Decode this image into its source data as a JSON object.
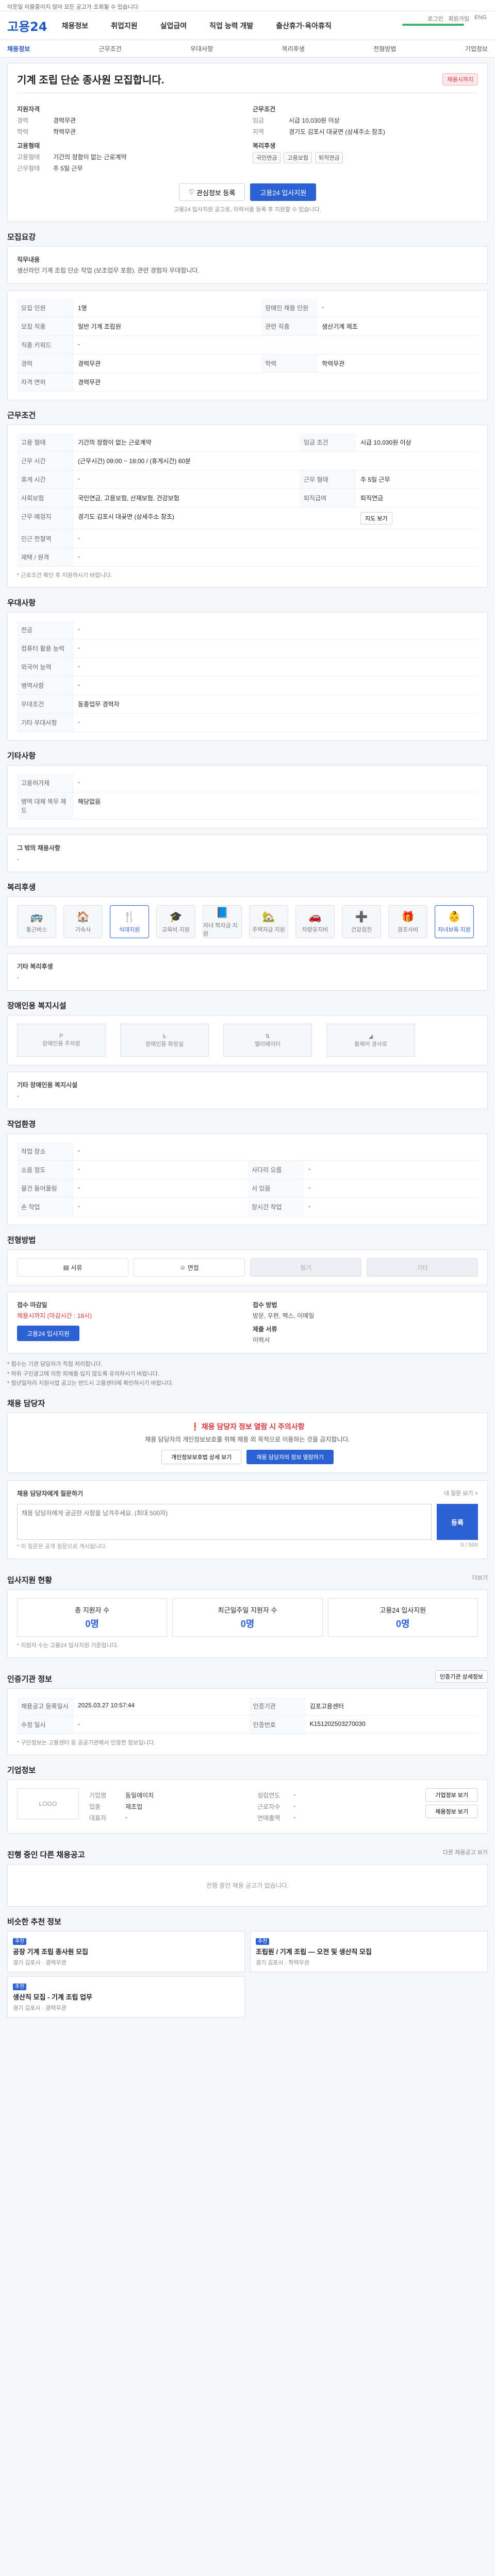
{
  "topbar": {
    "text": "이웃일 이용중이지 않아 모든 공고가 조회될 수 있습니다"
  },
  "header": {
    "logo": "고용24",
    "nav": [
      "채용정보",
      "취업지원",
      "실업급여",
      "직업 능력 개발",
      "출산휴가·육아휴직"
    ],
    "tools": [
      "로그인",
      "회원가입",
      "ENG"
    ]
  },
  "subnav": {
    "items": [
      "채용정보",
      "근무조건",
      "우대사항",
      "복리후생",
      "전형방법",
      "기업정보"
    ]
  },
  "job": {
    "title": "기계 조립 단순 종사원 모집합니다.",
    "badge": "채용시까지",
    "left_title": "지원자격",
    "left_rows": [
      {
        "k": "경력",
        "v": "경력무관"
      },
      {
        "k": "학력",
        "v": "학력무관"
      }
    ],
    "left_title2": "고용형태",
    "left_rows2": [
      {
        "k": "고용형태",
        "v": "기간의 정함이 없는 근로계약"
      },
      {
        "k": "근무형태",
        "v": "주 5일 근무"
      }
    ],
    "right_title": "근무조건",
    "right_rows": [
      {
        "k": "임금",
        "v": "시급 10,030원 이상"
      },
      {
        "k": "지역",
        "v": "경기도 김포시 대곶면 (상세주소 참조)"
      }
    ],
    "right_title2": "복리후생",
    "chips": [
      "국민연금",
      "고용보험",
      "퇴직연금"
    ],
    "btn_scrap": "관심정보 등록",
    "btn_apply": "고용24 입사지원",
    "note": "고용24 입사지원 공고로, 이력서를 등록 후 지원할 수 있습니다."
  },
  "duty": {
    "title": "모집요강",
    "box_title": "직무내용",
    "box_text": "생산라인 기계 조립 단순 작업 (보조업무 포함). 관련 경험자 우대합니다.",
    "rows": [
      [
        {
          "k": "모집 인원",
          "v": "1명"
        },
        {
          "k": "장애인 채용 인원",
          "v": "-"
        }
      ],
      [
        {
          "k": "모집 직종",
          "v": "일반 기계 조립원"
        },
        {
          "k": "관련 직종",
          "v": "생산기계 제조"
        }
      ],
      [
        {
          "k": "직종 키워드",
          "v": "-"
        },
        {
          "k": "",
          "v": ""
        }
      ],
      [
        {
          "k": "경력",
          "v": "경력무관"
        },
        {
          "k": "학력",
          "v": "학력무관"
        }
      ],
      [
        {
          "k": "자격 면허",
          "v": "경력무관"
        },
        {
          "k": "",
          "v": ""
        }
      ]
    ]
  },
  "cond": {
    "title": "근무조건",
    "rows": [
      [
        {
          "k": "고용 형태",
          "v": "기간의 정함이 없는 근로계약"
        },
        {
          "k": "임금 조건",
          "v": "시급 10,030원 이상"
        }
      ],
      [
        {
          "k": "근무 시간",
          "v": "(근무시간) 09:00 ~ 18:00 / (휴게시간) 60분"
        },
        {
          "k": "",
          "v": ""
        }
      ],
      [
        {
          "k": "휴게 시간",
          "v": "-"
        },
        {
          "k": "근무 형태",
          "v": "주 5일 근무"
        }
      ],
      [
        {
          "k": "사회보험",
          "v": "국민연금, 고용보험, 산재보험, 건강보험"
        },
        {
          "k": "퇴직급여",
          "v": "퇴직연금"
        }
      ],
      [
        {
          "k": "근무 예정지",
          "v": "경기도 김포시 대곶면 (상세주소 참조)"
        },
        {
          "k": "",
          "v": ""
        }
      ],
      [
        {
          "k": "인근 전철역",
          "v": "-"
        },
        {
          "k": "",
          "v": ""
        }
      ],
      [
        {
          "k": "재택 / 원격",
          "v": "-"
        },
        {
          "k": "",
          "v": ""
        }
      ]
    ],
    "map_btn": "지도 보기",
    "footnote": "* 근로조건 확인 후 지원하시기 바랍니다."
  },
  "prefer": {
    "title": "우대사항",
    "rows": [
      {
        "k": "전공",
        "v": "-"
      },
      {
        "k": "컴퓨터 활용 능력",
        "v": "-"
      },
      {
        "k": "외국어 능력",
        "v": "-"
      },
      {
        "k": "병역사항",
        "v": "-"
      },
      {
        "k": "우대조건",
        "v": "동종업무 경력자"
      },
      {
        "k": "기타 우대사항",
        "v": "-"
      }
    ]
  },
  "etc": {
    "title": "기타사항",
    "rows": [
      {
        "k": "고용허가제",
        "v": "-"
      },
      {
        "k": "병역 대체 복무 제도",
        "v": "해당없음"
      }
    ],
    "other_title": "그 밖의 채용사항",
    "other_text": "-"
  },
  "welfare": {
    "title": "복리후생",
    "items": [
      "통근버스",
      "기숙사",
      "식대지원",
      "교육비 지원",
      "자녀 학자금 지원",
      "주택자금 지원",
      "차량유지비",
      "건강검진",
      "경조사비",
      "자녀보육 지원"
    ],
    "extra_title": "기타 복리후생",
    "extra_text": "-"
  },
  "disabled": {
    "title": "장애인용 복지시설",
    "items": [
      "장애인용 주차장",
      "장애인용 화장실",
      "엘리베이터",
      "휠체어 경사로"
    ],
    "extra_title": "기타 장애인용 복지시설",
    "extra_text": "-"
  },
  "env": {
    "title": "작업환경",
    "rows": [
      [
        {
          "k": "작업 장소",
          "v": "-"
        },
        {
          "k": "",
          "v": ""
        }
      ],
      [
        {
          "k": "소음 정도",
          "v": "-"
        },
        {
          "k": "사다리 오름",
          "v": "-"
        }
      ],
      [
        {
          "k": "물건 들어올림",
          "v": "-"
        },
        {
          "k": "서 있음",
          "v": "-"
        }
      ],
      [
        {
          "k": "손 작업",
          "v": "-"
        },
        {
          "k": "장시간 작업",
          "v": "-"
        }
      ]
    ]
  },
  "process": {
    "title": "전형방법",
    "steps": [
      "서류",
      "면접",
      "필기",
      "기타"
    ],
    "apply_title": "접수 마감일",
    "apply_value": "채용시까지 (마감시간 : 18시)",
    "apply_btn": "고용24 입사지원",
    "method_title": "접수 방법",
    "method_value": "방문, 우편, 팩스, 이메일",
    "docs_title": "제출 서류",
    "docs_value": "이력서",
    "notes": [
      "* 접수는 기관 담당자가 직접 처리합니다.",
      "* 허위 구인광고에 의한 피해를 입지 않도록 유의하시기 바랍니다.",
      "* 청년일자리 지원사업 공고는 반드시 고용센터에 확인하시기 바랍니다."
    ]
  },
  "contact": {
    "title": "채용 담당자",
    "warn_title": "채용 담당자 정보 열람 시 주의사항",
    "warn_text": "채용 담당자의 개인정보보호를 위해 채용 외 목적으로 이용하는 것을 금지합니다.",
    "btn1": "개인정보보호법 상세 보기",
    "btn2": "채용 담당자의 정보 열람하기"
  },
  "qa": {
    "title": "채용 담당자에게 질문하기",
    "side": "내 질문 보기 >",
    "placeholder": "채용 담당자에게 궁금한 사항을 남겨주세요. (최대 500자)",
    "btn": "등록",
    "counter": "0 / 500",
    "notes": [
      "* 이 질문은 공개 질문으로 게시됩니다."
    ]
  },
  "stats": {
    "title": "입사지원 현황",
    "link": "더보기",
    "items": [
      {
        "k": "총 지원자 수",
        "v": "0명"
      },
      {
        "k": "최근일주일 지원자 수",
        "v": "0명"
      },
      {
        "k": "고용24 입사지원",
        "v": "0명"
      }
    ],
    "note": "* 지원자 수는 고용24 입사지원 기준입니다."
  },
  "info": {
    "title": "인증기관 정보",
    "btn": "인증기관 상세정보",
    "rows": [
      [
        {
          "k": "채용공고 등록일시",
          "v": "2025.03.27 10:57:44"
        },
        {
          "k": "인증기관",
          "v": "김포고용센터"
        }
      ],
      [
        {
          "k": "수정 일시",
          "v": "-"
        },
        {
          "k": "인증번호",
          "v": "K151202503270030"
        }
      ]
    ],
    "note": "* 구인정보는 고용센터 등 공공기관에서 인증한 정보입니다."
  },
  "company": {
    "title": "기업정보",
    "logo": "LOGO",
    "left": [
      {
        "k": "기업명",
        "v": "동일에이치"
      },
      {
        "k": "업종",
        "v": "제조업"
      },
      {
        "k": "대표자",
        "v": "-"
      }
    ],
    "right": [
      {
        "k": "설립연도",
        "v": "-"
      },
      {
        "k": "근로자수",
        "v": "-"
      },
      {
        "k": "연매출액",
        "v": "-"
      }
    ],
    "btn1": "기업정보 보기",
    "btn2": "채용정보 보기"
  },
  "ongoing": {
    "title": "진행 중인 다른 채용공고",
    "side": "다른 채용공고 보기",
    "empty": "진행 중인 채용 공고가 없습니다."
  },
  "recommend": {
    "title": "비슷한 추천 정보",
    "cards": [
      {
        "tag": "추천",
        "title": "공장 기계 조립 종사원 모집",
        "meta": "경기 김포시 · 경력무관"
      },
      {
        "tag": "추천",
        "title": "조립원 / 기계 조립 — 오전 및 생산직 모집",
        "meta": "경기 김포시 · 학력무관"
      },
      {
        "tag": "추천",
        "title": "생산직 모집 - 기계 조립 업무",
        "meta": "경기 김포시 · 경력무관"
      }
    ]
  }
}
